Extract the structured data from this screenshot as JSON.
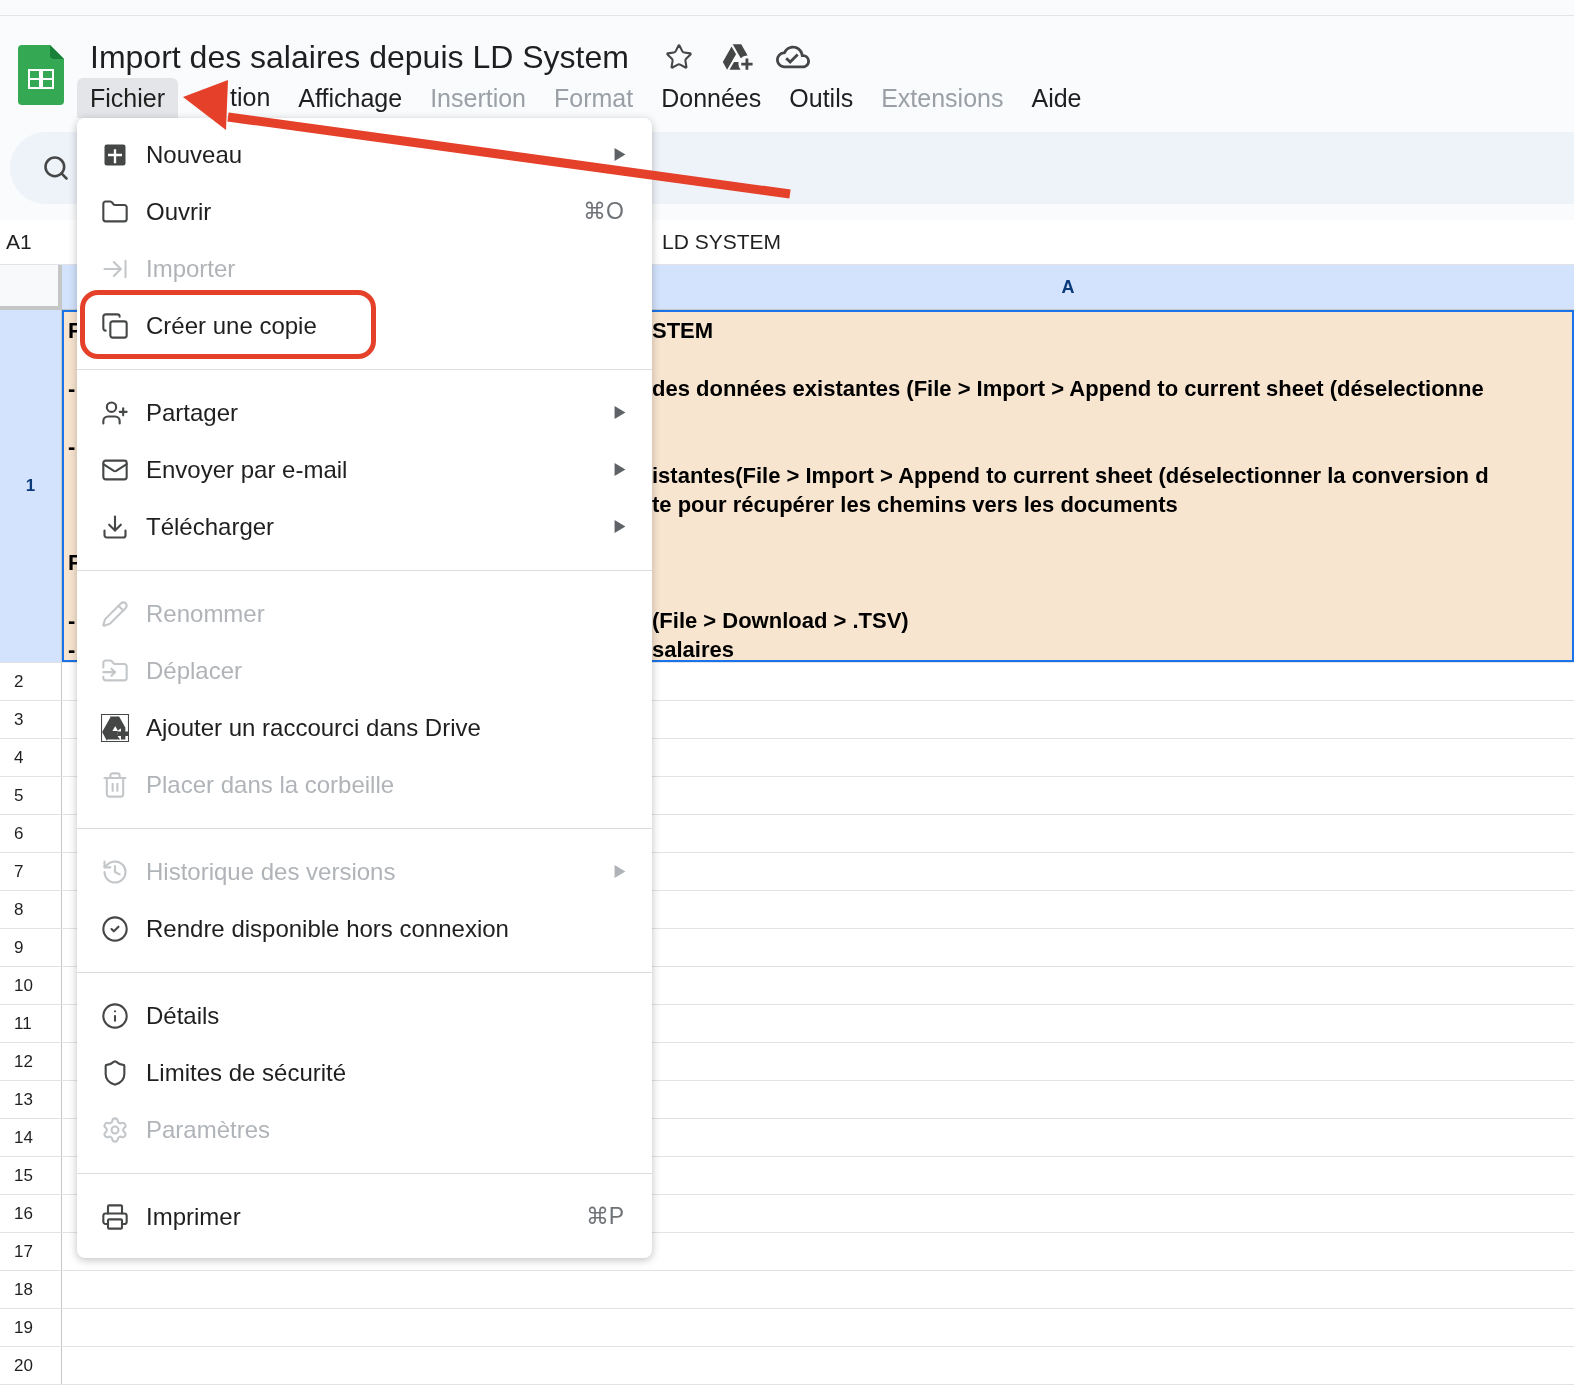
{
  "document": {
    "title": "Import des salaires depuis LD System"
  },
  "menu_bar": [
    {
      "label": "Fichier",
      "selected": true,
      "disabled": false,
      "covered": false
    },
    {
      "label": "tion",
      "selected": false,
      "disabled": false,
      "covered": true
    },
    {
      "label": "Affichage",
      "selected": false,
      "disabled": false,
      "covered": false
    },
    {
      "label": "Insertion",
      "selected": false,
      "disabled": true,
      "covered": false
    },
    {
      "label": "Format",
      "selected": false,
      "disabled": true,
      "covered": false
    },
    {
      "label": "Données",
      "selected": false,
      "disabled": false,
      "covered": false
    },
    {
      "label": "Outils",
      "selected": false,
      "disabled": false,
      "covered": false
    },
    {
      "label": "Extensions",
      "selected": false,
      "disabled": true,
      "covered": false
    },
    {
      "label": "Aide",
      "selected": false,
      "disabled": false,
      "covered": false
    }
  ],
  "formula_bar": {
    "cell_ref": "A1",
    "value": "LD SYSTEM"
  },
  "columns": [
    {
      "label": "A",
      "selected": true
    }
  ],
  "rows": [
    {
      "label": "1",
      "selected": true,
      "lines": [
        {
          "kind": "text",
          "left": "F",
          "right": "STEM"
        },
        {
          "kind": "blank"
        },
        {
          "kind": "text",
          "left": "-",
          "right": "des données existantes (File > Import > Append to current sheet (déselectionne"
        },
        {
          "kind": "blank"
        },
        {
          "kind": "text",
          "left": "-"
        },
        {
          "kind": "text",
          "right": "istantes(File > Import > Append to current sheet (déselectionner la conversion d"
        },
        {
          "kind": "text",
          "right": "te pour récupérer les chemins vers les documents"
        },
        {
          "kind": "blank"
        },
        {
          "kind": "text",
          "left": "F"
        },
        {
          "kind": "blank"
        },
        {
          "kind": "text",
          "left": "-",
          "right": "(File > Download > .TSV)"
        },
        {
          "kind": "text",
          "left": "-",
          "right": "salaires"
        }
      ]
    },
    {
      "label": "2",
      "selected": false
    },
    {
      "label": "3",
      "selected": false
    },
    {
      "label": "4",
      "selected": false
    },
    {
      "label": "5",
      "selected": false
    },
    {
      "label": "6",
      "selected": false
    },
    {
      "label": "7",
      "selected": false
    },
    {
      "label": "8",
      "selected": false
    },
    {
      "label": "9",
      "selected": false
    },
    {
      "label": "10",
      "selected": false
    },
    {
      "label": "11",
      "selected": false
    },
    {
      "label": "12",
      "selected": false
    },
    {
      "label": "13",
      "selected": false
    },
    {
      "label": "14",
      "selected": false
    },
    {
      "label": "15",
      "selected": false
    },
    {
      "label": "16",
      "selected": false
    },
    {
      "label": "17",
      "selected": false
    },
    {
      "label": "18",
      "selected": false
    },
    {
      "label": "19",
      "selected": false
    },
    {
      "label": "20",
      "selected": false
    }
  ],
  "file_menu": {
    "items": [
      {
        "kind": "item",
        "label": "Nouveau",
        "disabled": false,
        "submenu": true,
        "highlighted": false
      },
      {
        "kind": "item",
        "label": "Ouvrir",
        "disabled": false,
        "submenu": false,
        "highlighted": false,
        "shortcut": "⌘O"
      },
      {
        "kind": "item",
        "label": "Importer",
        "disabled": true,
        "submenu": false,
        "highlighted": false
      },
      {
        "kind": "item",
        "label": "Créer une copie",
        "disabled": false,
        "submenu": false,
        "highlighted": true
      },
      {
        "kind": "separator"
      },
      {
        "kind": "item",
        "label": "Partager",
        "disabled": false,
        "submenu": true,
        "highlighted": false
      },
      {
        "kind": "item",
        "label": "Envoyer par e-mail",
        "disabled": false,
        "submenu": true,
        "highlighted": false
      },
      {
        "kind": "item",
        "label": "Télécharger",
        "disabled": false,
        "submenu": true,
        "highlighted": false
      },
      {
        "kind": "separator"
      },
      {
        "kind": "item",
        "label": "Renommer",
        "disabled": true,
        "submenu": false,
        "highlighted": false
      },
      {
        "kind": "item",
        "label": "Déplacer",
        "disabled": true,
        "submenu": false,
        "highlighted": false
      },
      {
        "kind": "item",
        "label": "Ajouter un raccourci dans Drive",
        "disabled": false,
        "submenu": false,
        "highlighted": false
      },
      {
        "kind": "item",
        "label": "Placer dans la corbeille",
        "disabled": true,
        "submenu": false,
        "highlighted": false
      },
      {
        "kind": "separator"
      },
      {
        "kind": "item",
        "label": "Historique des versions",
        "disabled": true,
        "submenu": true,
        "highlighted": false
      },
      {
        "kind": "item",
        "label": "Rendre disponible hors connexion",
        "disabled": false,
        "submenu": false,
        "highlighted": false
      },
      {
        "kind": "separator"
      },
      {
        "kind": "item",
        "label": "Détails",
        "disabled": false,
        "submenu": false,
        "highlighted": false
      },
      {
        "kind": "item",
        "label": "Limites de sécurité",
        "disabled": false,
        "submenu": false,
        "highlighted": false
      },
      {
        "kind": "item",
        "label": "Paramètres",
        "disabled": true,
        "submenu": false,
        "highlighted": false
      },
      {
        "kind": "separator"
      },
      {
        "kind": "item",
        "label": "Imprimer",
        "disabled": false,
        "submenu": false,
        "highlighted": false,
        "shortcut": "⌘P"
      }
    ]
  }
}
